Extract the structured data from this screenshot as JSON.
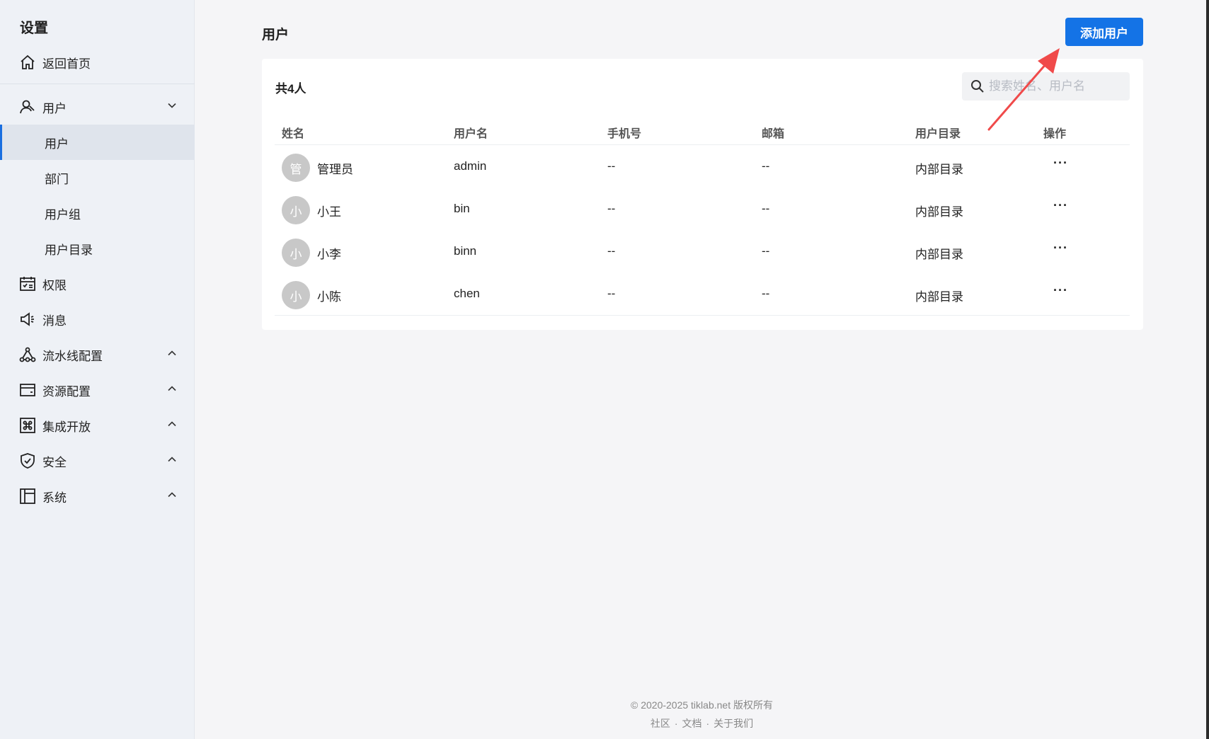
{
  "sidebar": {
    "title": "设置",
    "home": "返回首页",
    "user_group": "用户",
    "sub_items": [
      "用户",
      "部门",
      "用户组",
      "用户目录"
    ],
    "items": [
      "权限",
      "消息",
      "流水线配置",
      "资源配置",
      "集成开放",
      "安全",
      "系统"
    ]
  },
  "header": {
    "title": "用户",
    "add_button": "添加用户"
  },
  "table": {
    "count": "共4人",
    "search_placeholder": "搜索姓名、用户名",
    "columns": [
      "姓名",
      "用户名",
      "手机号",
      "邮箱",
      "用户目录",
      "操作"
    ],
    "rows": [
      {
        "avatar": "管",
        "name": "管理员",
        "username": "admin",
        "phone": "--",
        "email": "--",
        "directory": "内部目录",
        "action": "···"
      },
      {
        "avatar": "小",
        "name": "小王",
        "username": "bin",
        "phone": "--",
        "email": "--",
        "directory": "内部目录",
        "action": "···"
      },
      {
        "avatar": "小",
        "name": "小李",
        "username": "binn",
        "phone": "--",
        "email": "--",
        "directory": "内部目录",
        "action": "···"
      },
      {
        "avatar": "小",
        "name": "小陈",
        "username": "chen",
        "phone": "--",
        "email": "--",
        "directory": "内部目录",
        "action": "···"
      }
    ]
  },
  "footer": {
    "copyright": "© 2020-2025 tiklab.net 版权所有",
    "links": [
      "社区",
      "文档",
      "关于我们"
    ]
  },
  "colors": {
    "accent": "#1473e6",
    "annotation_arrow": "#f04a4a"
  }
}
